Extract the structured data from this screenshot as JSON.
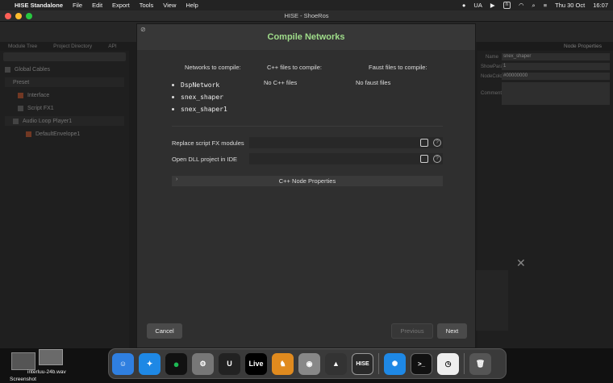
{
  "menubar": {
    "app_name": "HISE Standalone",
    "menus": [
      "File",
      "Edit",
      "Export",
      "Tools",
      "View",
      "Help"
    ],
    "input_source": "UA",
    "status_box": "n",
    "date": "Thu 30 Oct",
    "time": "16:07"
  },
  "window": {
    "title": "HISE - ShoeRos"
  },
  "background_app": {
    "left_tabs": [
      "Module Tree",
      "Project Directory",
      "API"
    ],
    "tree": {
      "global": "Global Cables",
      "preset": "Preset",
      "interface": "Interface",
      "script_fx": "Script FX1",
      "loop_player": "Audio Loop Player1",
      "envelope": "DefaultEnvelope1"
    },
    "right_panel": {
      "title": "Node Properties",
      "rows": [
        {
          "label": "Name",
          "value": "snex_shaper"
        },
        {
          "label": "ShowParameters",
          "value": "1"
        },
        {
          "label": "NodeColour",
          "value": "#00000000"
        },
        {
          "label": "Comment",
          "value": ""
        }
      ]
    }
  },
  "dialog": {
    "title": "Compile Networks",
    "columns": {
      "networks_header": "Networks to compile:",
      "cpp_header": "C++ files to compile:",
      "faust_header": "Faust files to compile:"
    },
    "networks": [
      "DspNetwork",
      "snex_shaper",
      "snex_shaper1"
    ],
    "cpp_files_text": "No C++ files",
    "faust_files_text": "No faust files",
    "options": [
      {
        "label": "Replace script FX modules",
        "checked": false,
        "help": "?"
      },
      {
        "label": "Open DLL project in IDE",
        "checked": false,
        "help": "?"
      }
    ],
    "section": "C++ Node Properties",
    "buttons": {
      "cancel": "Cancel",
      "previous": "Previous",
      "next": "Next"
    }
  },
  "desktop": {
    "file_label": "interluu-24b.wav",
    "screenshot_label": "Screenshot"
  },
  "dock": {
    "live_label": "Live",
    "hise_label": "HISE",
    "terminal_label": ">_"
  },
  "colors": {
    "accent_green": "#9fdc8a",
    "dialog_bg": "#2f2f2f"
  }
}
